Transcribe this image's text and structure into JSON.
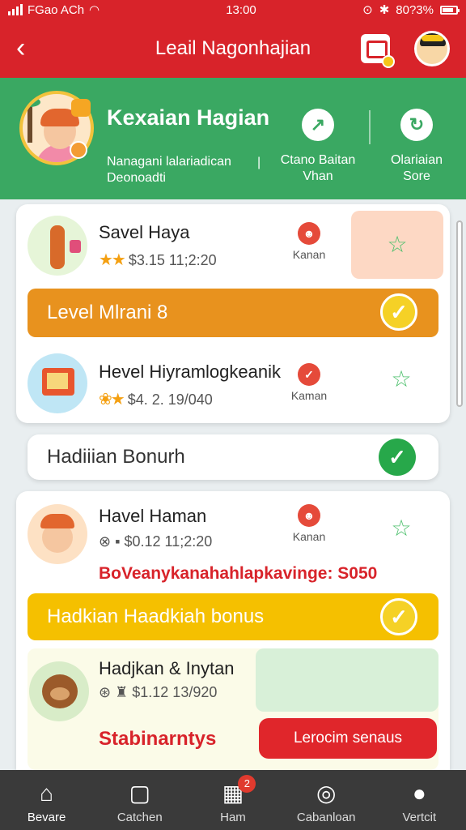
{
  "status_bar": {
    "carrier": "FGao ACh",
    "time": "13:00",
    "battery_text": "80?3%",
    "battery_level_percent": 80
  },
  "app_bar": {
    "back_icon": "chevron-left-icon",
    "title": "Leail Nagonhajian",
    "clipboard_icon": "clipboard-icon",
    "avatar_icon": "avatar"
  },
  "profile": {
    "name": "Kexaian Hagian",
    "subtitle_line1": "Nanagani lalariadican",
    "subtitle_line2": "Deonoadti",
    "divider": "|",
    "action1": {
      "label_line1": "Ctano Baitan",
      "label_line2": "Vhan",
      "icon": "compass-icon"
    },
    "action2": {
      "label_line1": "Olariaian",
      "label_line2": "Sore",
      "icon": "refresh-icon"
    }
  },
  "card1": {
    "item1": {
      "title": "Savel Haya",
      "stars": "★★",
      "meta": "$3.15 11;2:20",
      "mini_label": "Kanan",
      "star_icon": "star-icon"
    },
    "banner": {
      "label": "Level Mlrani 8"
    },
    "item2": {
      "title": "Hevel Hiyramlogkeanik",
      "stars": "❀★",
      "meta": "$4. 2. 19/040",
      "mini_label": "Kaman",
      "star_icon": "star-icon"
    }
  },
  "bonus_row": {
    "label": "Hadiiian Bonurh"
  },
  "card2": {
    "item1": {
      "title": "Havel Haman",
      "meta": "$0.12 11;2:20",
      "mini_label": "Kanan",
      "star_icon": "star-icon"
    },
    "promo_text": "BoVeanykanahahlapkavinge: S050",
    "banner": {
      "label": "Hadkian  Haadkiah bonus"
    },
    "item2": {
      "title": "Hadjkan & Inytan",
      "meta": "$1.12 13/920"
    },
    "footer_left": "Stabinarntys",
    "footer_button": "Lerocim senaus"
  },
  "nav": [
    {
      "label": "Bevare",
      "icon": "home-icon",
      "active": true
    },
    {
      "label": "Catchen",
      "icon": "calendar-icon",
      "active": false
    },
    {
      "label": "Ham",
      "icon": "grid-icon",
      "badge": "2",
      "active": false
    },
    {
      "label": "Cabanloan",
      "icon": "chat-icon",
      "active": false
    },
    {
      "label": "Vertcit",
      "icon": "user-icon",
      "active": false
    }
  ],
  "colors": {
    "red": "#d8232a",
    "green": "#3aa862",
    "orange": "#e8921e",
    "yellow": "#f5c000",
    "nav_bg": "#3a3a3a"
  }
}
